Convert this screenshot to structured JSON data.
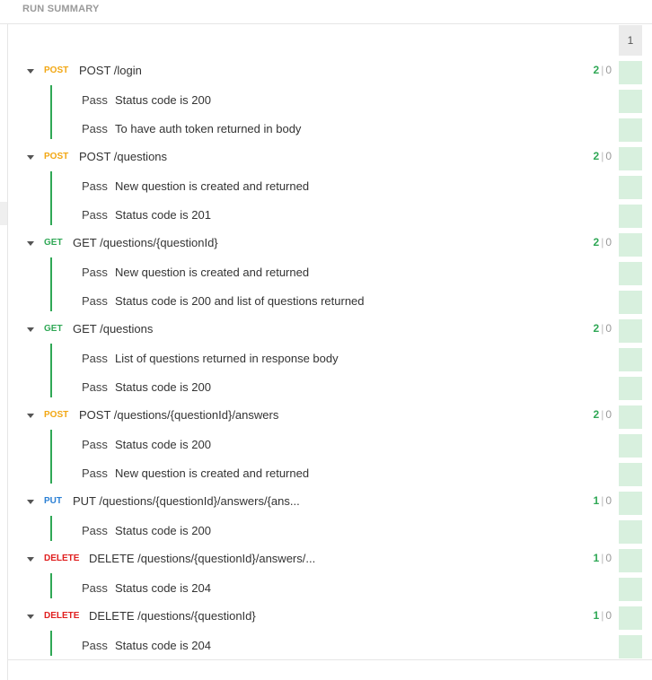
{
  "header": {
    "title": "RUN SUMMARY"
  },
  "iteration": {
    "label": "1"
  },
  "colors": {
    "POST": "#f2a713",
    "GET": "#30a856",
    "PUT": "#2a7fd4",
    "DELETE": "#e01f1f",
    "pass": "#30a856"
  },
  "requests": [
    {
      "method": "POST",
      "name": "POST /login",
      "passed": "2",
      "failed": "0",
      "tests": [
        {
          "status": "Pass",
          "name": "Status code is 200"
        },
        {
          "status": "Pass",
          "name": "To have auth token returned in body"
        }
      ]
    },
    {
      "method": "POST",
      "name": "POST /questions",
      "passed": "2",
      "failed": "0",
      "tests": [
        {
          "status": "Pass",
          "name": "New question is created and returned"
        },
        {
          "status": "Pass",
          "name": "Status code is 201"
        }
      ]
    },
    {
      "method": "GET",
      "name": "GET /questions/{questionId}",
      "passed": "2",
      "failed": "0",
      "tests": [
        {
          "status": "Pass",
          "name": "New question is created and returned"
        },
        {
          "status": "Pass",
          "name": "Status code is 200 and list of questions returned"
        }
      ]
    },
    {
      "method": "GET",
      "name": "GET /questions",
      "passed": "2",
      "failed": "0",
      "tests": [
        {
          "status": "Pass",
          "name": "List of questions returned in response body"
        },
        {
          "status": "Pass",
          "name": "Status code is 200"
        }
      ]
    },
    {
      "method": "POST",
      "name": "POST /questions/{questionId}/answers",
      "passed": "2",
      "failed": "0",
      "tests": [
        {
          "status": "Pass",
          "name": "Status code is 200"
        },
        {
          "status": "Pass",
          "name": "New question is created and returned"
        }
      ]
    },
    {
      "method": "PUT",
      "name": "PUT /questions/{questionId}/answers/{ans...",
      "passed": "1",
      "failed": "0",
      "tests": [
        {
          "status": "Pass",
          "name": "Status code is 200"
        }
      ]
    },
    {
      "method": "DELETE",
      "name": "DELETE /questions/{questionId}/answers/...",
      "passed": "1",
      "failed": "0",
      "tests": [
        {
          "status": "Pass",
          "name": "Status code is 204"
        }
      ]
    },
    {
      "method": "DELETE",
      "name": "DELETE /questions/{questionId}",
      "passed": "1",
      "failed": "0",
      "tests": [
        {
          "status": "Pass",
          "name": "Status code is 204"
        }
      ]
    }
  ]
}
